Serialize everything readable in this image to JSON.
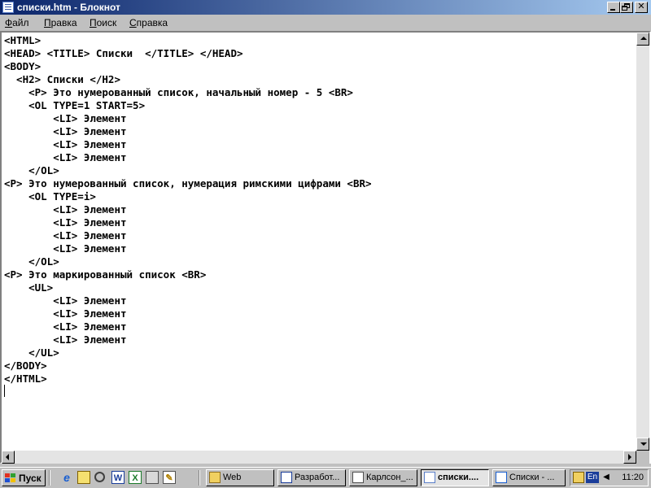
{
  "window": {
    "title": "списки.htm - Блокнот",
    "menu": [
      "Файл",
      "Правка",
      "Поиск",
      "Справка"
    ]
  },
  "document": {
    "lines": [
      "<HTML>",
      "<HEAD> <TITLE> Списки  </TITLE> </HEAD>",
      "<BODY>",
      "  <H2> Списки </H2>",
      "    <P> Это нумерованный список, начальный номер - 5 <BR>",
      "    <OL TYPE=1 START=5>",
      "        <LI> Элемент",
      "        <LI> Элемент",
      "        <LI> Элемент",
      "        <LI> Элемент",
      "    </OL>",
      "<P> Это нумерованный список, нумерация римскими цифрами <BR>",
      "    <OL TYPE=i>",
      "        <LI> Элемент",
      "        <LI> Элемент",
      "        <LI> Элемент",
      "        <LI> Элемент",
      "    </OL>",
      "<P> Это маркированный список <BR>",
      "    <UL>",
      "        <LI> Элемент",
      "        <LI> Элемент",
      "        <LI> Элемент",
      "        <LI> Элемент",
      "    </UL>",
      "</BODY>",
      "</HTML>"
    ]
  },
  "taskbar": {
    "start_label": "Пуск",
    "quick_launch": [
      "ie-icon",
      "outlook-icon",
      "search-icon",
      "word-icon",
      "excel-icon",
      "printer-icon",
      "draw-icon"
    ],
    "tasks": [
      {
        "label": "Web",
        "icon": "folder-icon",
        "active": false
      },
      {
        "label": "Разработ...",
        "icon": "word-icon",
        "active": false
      },
      {
        "label": "Карлсон_...",
        "icon": "paint-icon",
        "active": false
      },
      {
        "label": "списки....",
        "icon": "notepad-icon",
        "active": true
      },
      {
        "label": "Списки - ...",
        "icon": "browser-icon",
        "active": false
      }
    ],
    "tray": {
      "language": "En",
      "clock": "11:20"
    }
  },
  "colors": {
    "titlebar_start": "#0a246a",
    "titlebar_end": "#a6caf0",
    "face": "#c0c0c0"
  }
}
